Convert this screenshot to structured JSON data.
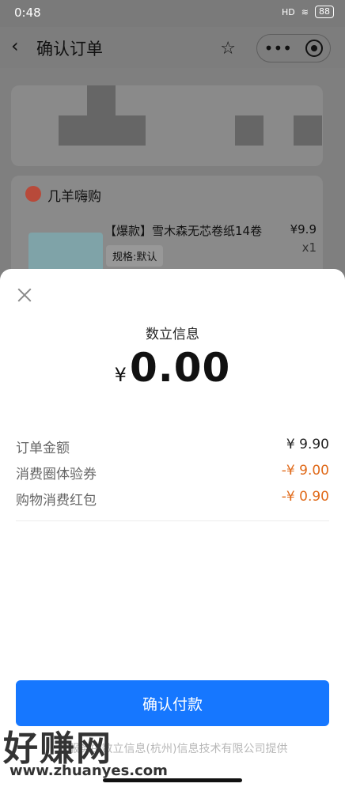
{
  "status": {
    "time": "0:48",
    "network": "HD",
    "battery": "88"
  },
  "nav": {
    "back_icon": "chevron-left",
    "title": "确认订单",
    "star_icon": "star-outline",
    "more_icon": "more-dots",
    "close_icon": "circle-target"
  },
  "store": {
    "name": "几羊嗨购"
  },
  "product": {
    "name": "【爆款】雪木森无芯卷纸14卷",
    "spec": "规格:默认",
    "price": "¥9.9",
    "qty": "x1"
  },
  "sheet": {
    "title": "数立信息",
    "currency": "¥",
    "amount": "0.00",
    "rows": [
      {
        "label": "订单金额",
        "value": "¥ 9.90",
        "accent": false
      },
      {
        "label": "消费圈体验券",
        "value": "-¥ 9.00",
        "accent": true
      },
      {
        "label": "购物消费红包",
        "value": "-¥ 0.90",
        "accent": true
      }
    ],
    "confirm_label": "确认付款",
    "footer": "本服务由数立信息(杭州)信息技术有限公司提供"
  },
  "watermark": {
    "cn": "好赚网",
    "url": "www.zhuanyes.com"
  },
  "colors": {
    "accent_blue": "#1677ff",
    "discount_orange": "#e06a1a"
  }
}
